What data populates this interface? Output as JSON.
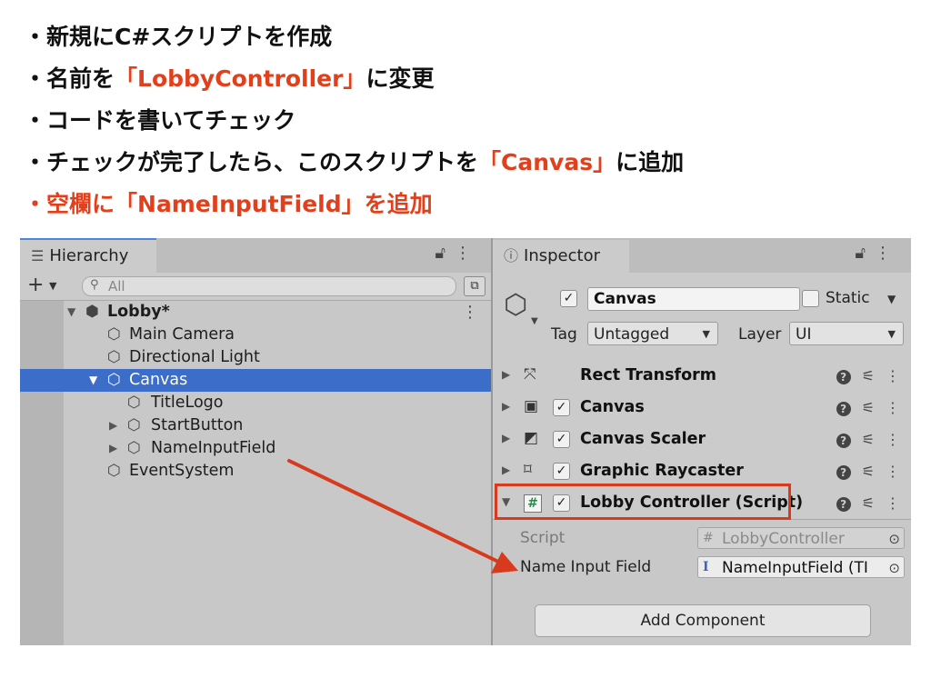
{
  "instructions": {
    "lines": [
      {
        "bullet": "・",
        "text": "新規にC#スクリプトを作成"
      },
      {
        "bullet": "・",
        "pre": "名前を",
        "highlight": "「LobbyController」",
        "post": "に変更"
      },
      {
        "bullet": "・",
        "text": "コードを書いてチェック"
      },
      {
        "bullet": "・",
        "pre": "チェックが完了したら、このスクリプトを",
        "highlight": "「Canvas」",
        "post": "に追加"
      },
      {
        "bullet": "・",
        "text": "空欄に「NameInputField」を追加"
      }
    ]
  },
  "hierarchy": {
    "tab_label": "Hierarchy",
    "search_placeholder": "All",
    "scene": "Lobby*",
    "items": [
      {
        "label": "Main Camera"
      },
      {
        "label": "Directional Light"
      },
      {
        "label": "Canvas"
      },
      {
        "label": "TitleLogo"
      },
      {
        "label": "StartButton"
      },
      {
        "label": "NameInputField"
      },
      {
        "label": "EventSystem"
      }
    ]
  },
  "inspector": {
    "tab_label": "Inspector",
    "object_name": "Canvas",
    "static_label": "Static",
    "tag_label": "Tag",
    "tag_value": "Untagged",
    "layer_label": "Layer",
    "layer_value": "UI",
    "components": [
      {
        "name": "Rect Transform"
      },
      {
        "name": "Canvas"
      },
      {
        "name": "Canvas Scaler"
      },
      {
        "name": "Graphic Raycaster"
      },
      {
        "name": "Lobby Controller (Script)"
      }
    ],
    "properties": [
      {
        "label": "Script",
        "value": "LobbyController"
      },
      {
        "label": "Name Input Field",
        "value": "NameInputField (TI"
      }
    ],
    "add_component_label": "Add Component"
  },
  "colors": {
    "highlight": "#e2401c",
    "selection": "#3c6dc8"
  }
}
